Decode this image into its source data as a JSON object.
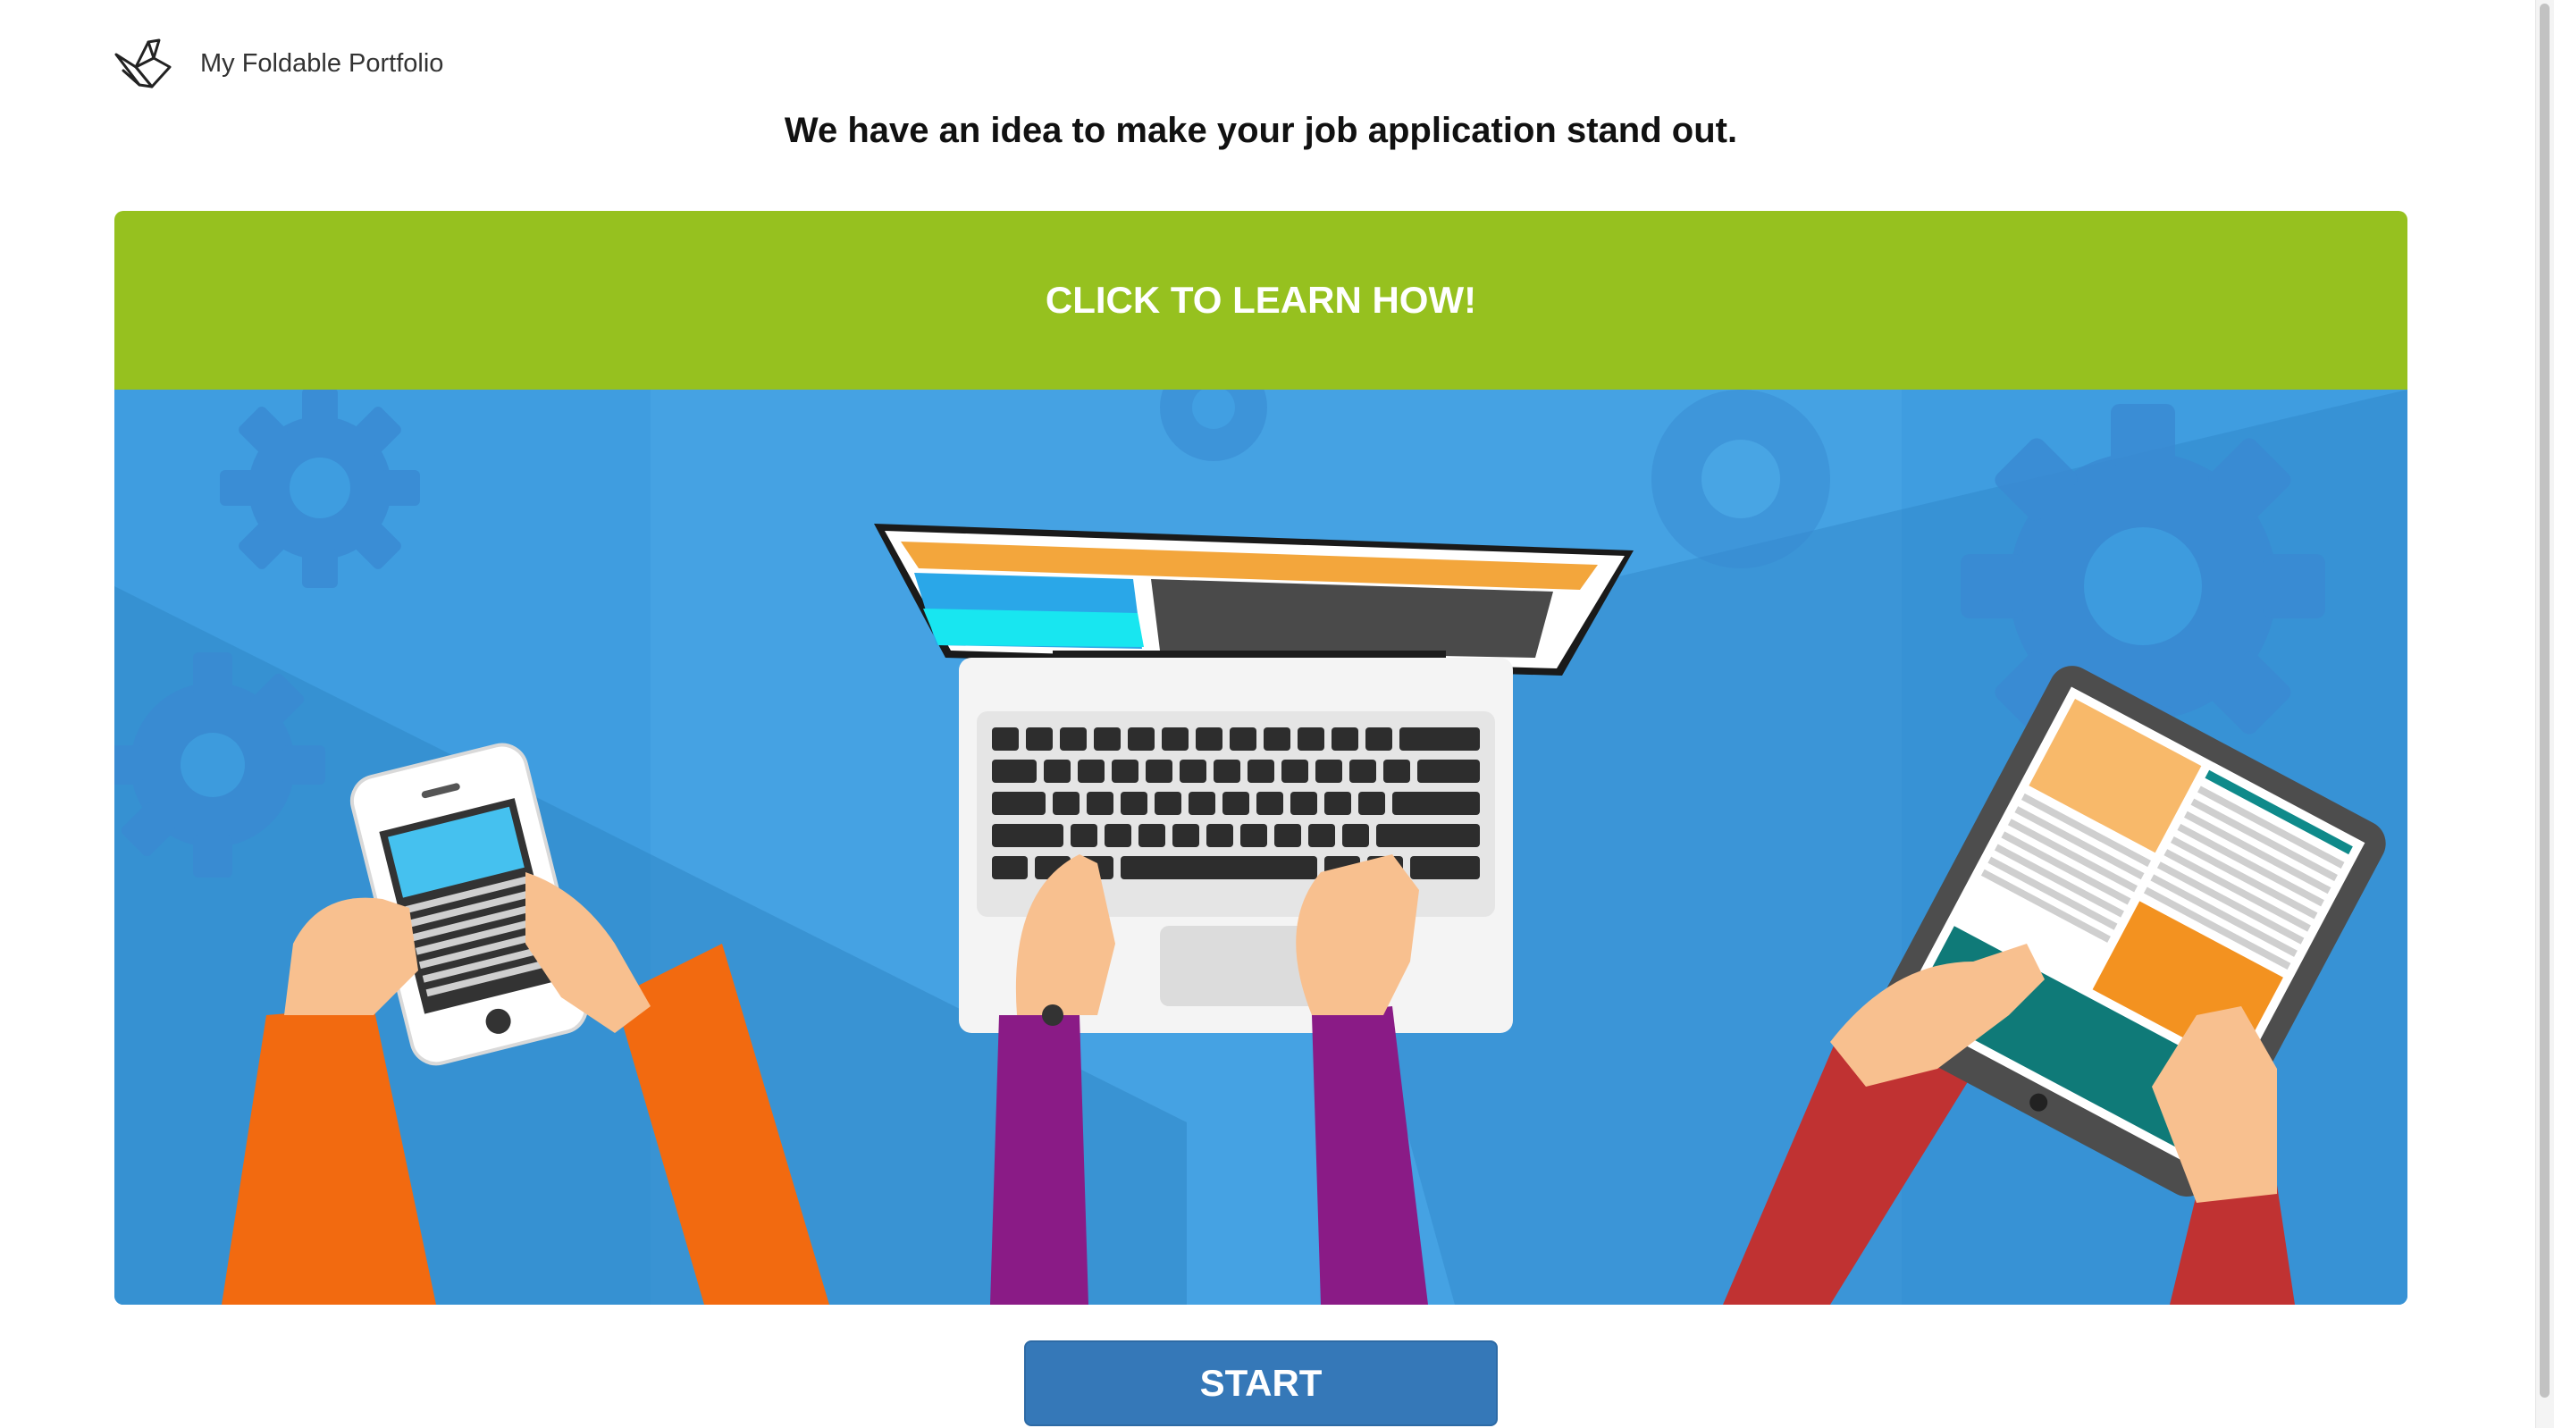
{
  "header": {
    "brand_name": "My Foldable Portfolio",
    "logo_icon": "origami-bird-icon"
  },
  "headline": "We have an idea to make your job application stand out.",
  "banner": {
    "label": "CLICK TO LEARN HOW!",
    "color": "#96c11f"
  },
  "hero": {
    "background_color": "#3f9de0",
    "illustration": [
      "smartphone",
      "laptop",
      "tablet",
      "gear"
    ]
  },
  "start_button": {
    "label": "START",
    "color": "#3578b8"
  }
}
